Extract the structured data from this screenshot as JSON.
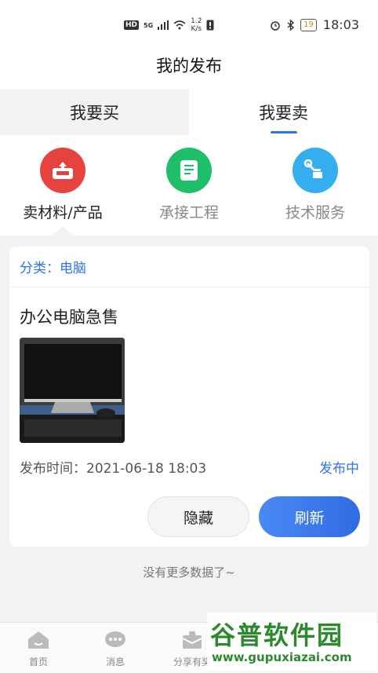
{
  "status_bar": {
    "hd": "HD",
    "signal": "5G",
    "net_speed": "1.2",
    "net_unit": "K/s",
    "battery": "19",
    "time": "18:03"
  },
  "header": {
    "title": "我的发布"
  },
  "tabs": [
    {
      "label": "我要买",
      "active": false
    },
    {
      "label": "我要卖",
      "active": true
    }
  ],
  "categories": [
    {
      "label": "卖材料/产品",
      "icon": "upload-tray-icon",
      "color": "#e64340",
      "selected": true
    },
    {
      "label": "承接工程",
      "icon": "document-icon",
      "color": "#1fbf6a",
      "selected": false
    },
    {
      "label": "技术服务",
      "icon": "wrench-hand-icon",
      "color": "#35aef0",
      "selected": false
    }
  ],
  "post": {
    "category_prefix": "分类：",
    "category": "电脑",
    "title": "办公电脑急售",
    "time_prefix": "发布时间：",
    "time": "2021-06-18 18:03",
    "status": "发布中",
    "hide_label": "隐藏",
    "refresh_label": "刷新"
  },
  "list": {
    "no_more": "没有更多数据了~"
  },
  "bottom_nav": [
    {
      "label": "首页",
      "icon": "home-icon"
    },
    {
      "label": "消息",
      "icon": "message-icon"
    },
    {
      "label": "分享有奖",
      "icon": "gift-icon"
    }
  ],
  "watermark": {
    "title": "谷普软件园",
    "url": "www.gupuxiazai.com"
  },
  "colors": {
    "accent": "#2f73e8",
    "watermark": "#2c8a2c"
  }
}
